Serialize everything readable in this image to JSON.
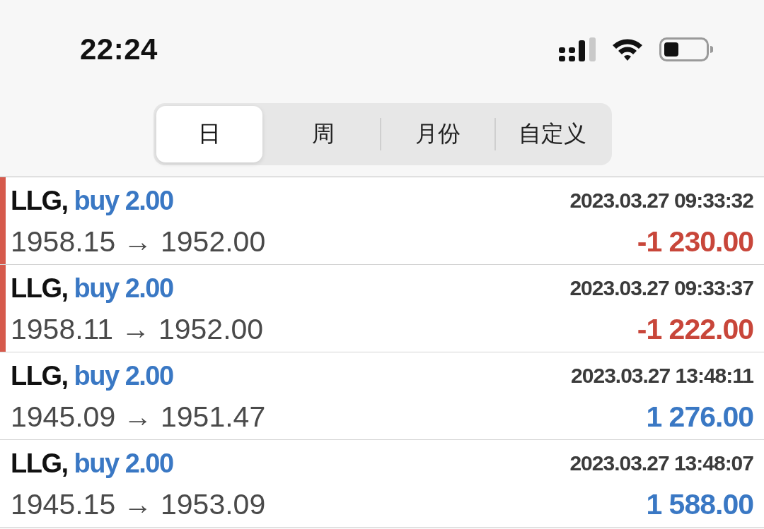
{
  "status_bar": {
    "time": "22:24"
  },
  "tabs": [
    {
      "label": "日",
      "selected": true
    },
    {
      "label": "周",
      "selected": false
    },
    {
      "label": "月份",
      "selected": false
    },
    {
      "label": "自定义",
      "selected": false
    }
  ],
  "trades": [
    {
      "symbol": "LLG,",
      "order": "buy 2.00",
      "time": "2023.03.27 09:33:32",
      "prices": "1958.15 → 1952.00",
      "profit": "-1 230.00",
      "loss": true
    },
    {
      "symbol": "LLG,",
      "order": "buy 2.00",
      "time": "2023.03.27 09:33:37",
      "prices": "1958.11 → 1952.00",
      "profit": "-1 222.00",
      "loss": true
    },
    {
      "symbol": "LLG,",
      "order": "buy 2.00",
      "time": "2023.03.27 13:48:11",
      "prices": "1945.09 → 1951.47",
      "profit": "1 276.00",
      "loss": false
    },
    {
      "symbol": "LLG,",
      "order": "buy 2.00",
      "time": "2023.03.27 13:48:07",
      "prices": "1945.15 → 1953.09",
      "profit": "1 588.00",
      "loss": false
    }
  ]
}
